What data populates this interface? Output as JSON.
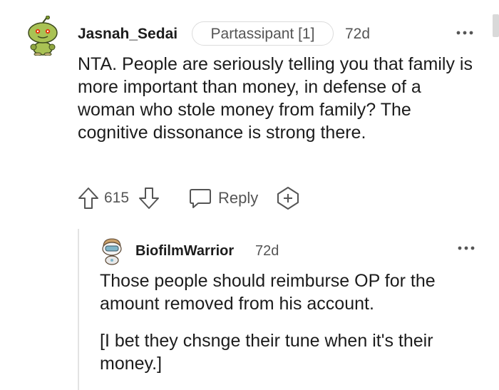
{
  "comment": {
    "username": "Jasnah_Sedai",
    "flair": "Partassipant [1]",
    "time": "72d",
    "body": "NTA. People are seriously telling you that family is more important than money, in defense of a woman who stole money from family? The cognitive dissonance is strong there.",
    "score": "615",
    "reply_label": "Reply",
    "avatar_icon": "snoo-avatar-icon",
    "colors": {
      "text": "#1c1c1c",
      "meta": "#555555",
      "border": "#dcdcdc"
    }
  },
  "reply": {
    "username": "BiofilmWarrior",
    "time": "72d",
    "paragraph1": "Those people should reimburse OP for the amount removed from his account.",
    "paragraph2": "[I bet they chsnge their tune when it's their money.]",
    "avatar_icon": "snoo-avatar-icon"
  }
}
